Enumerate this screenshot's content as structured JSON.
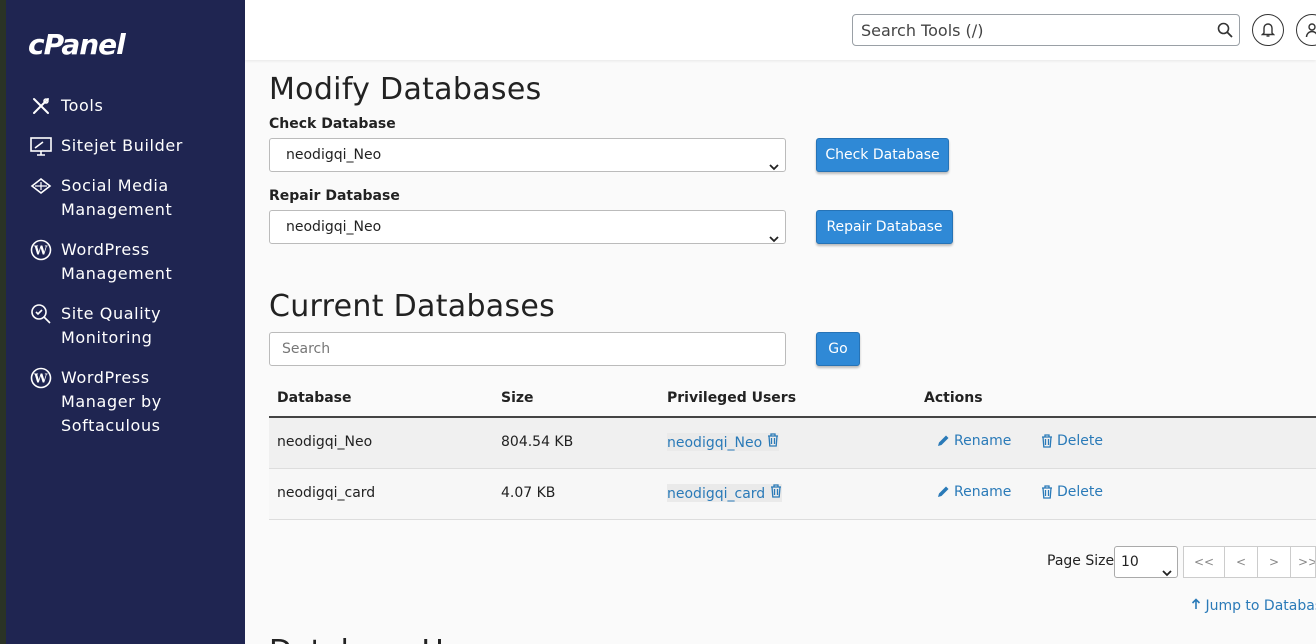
{
  "sidebar": {
    "logo": "cPanel",
    "items": [
      {
        "label": "Tools",
        "icon": "tools-icon"
      },
      {
        "label": "Sitejet Builder",
        "icon": "sitejet-icon"
      },
      {
        "label": "Social Media Management",
        "icon": "social-media-icon"
      },
      {
        "label": "WordPress Management",
        "icon": "wordpress-icon"
      },
      {
        "label": "Site Quality Monitoring",
        "icon": "site-quality-icon"
      },
      {
        "label": "WordPress Manager by Softaculous",
        "icon": "wordpress-icon"
      }
    ]
  },
  "header": {
    "search_placeholder": "Search Tools (/)"
  },
  "modify": {
    "title": "Modify Databases",
    "check_label": "Check Database",
    "check_value": "neodigqi_Neo",
    "check_button": "Check Database",
    "repair_label": "Repair Database",
    "repair_value": "neodigqi_Neo",
    "repair_button": "Repair Database"
  },
  "current": {
    "title": "Current Databases",
    "search_placeholder": "Search",
    "go_button": "Go",
    "columns": [
      "Database",
      "Size",
      "Privileged Users",
      "Actions"
    ],
    "rows": [
      {
        "database": "neodigqi_Neo",
        "size": "804.54 KB",
        "user": "neodigqi_Neo",
        "rename": "Rename",
        "delete": "Delete"
      },
      {
        "database": "neodigqi_card",
        "size": "4.07 KB",
        "user": "neodigqi_card",
        "rename": "Rename",
        "delete": "Delete"
      }
    ]
  },
  "pager": {
    "page_size_label": "Page Size",
    "page_size_value": "10",
    "first": "<<",
    "prev": "<",
    "next": ">",
    "last": ">>"
  },
  "jump_link": "Jump to Databas",
  "next_section_title": "Database U"
}
